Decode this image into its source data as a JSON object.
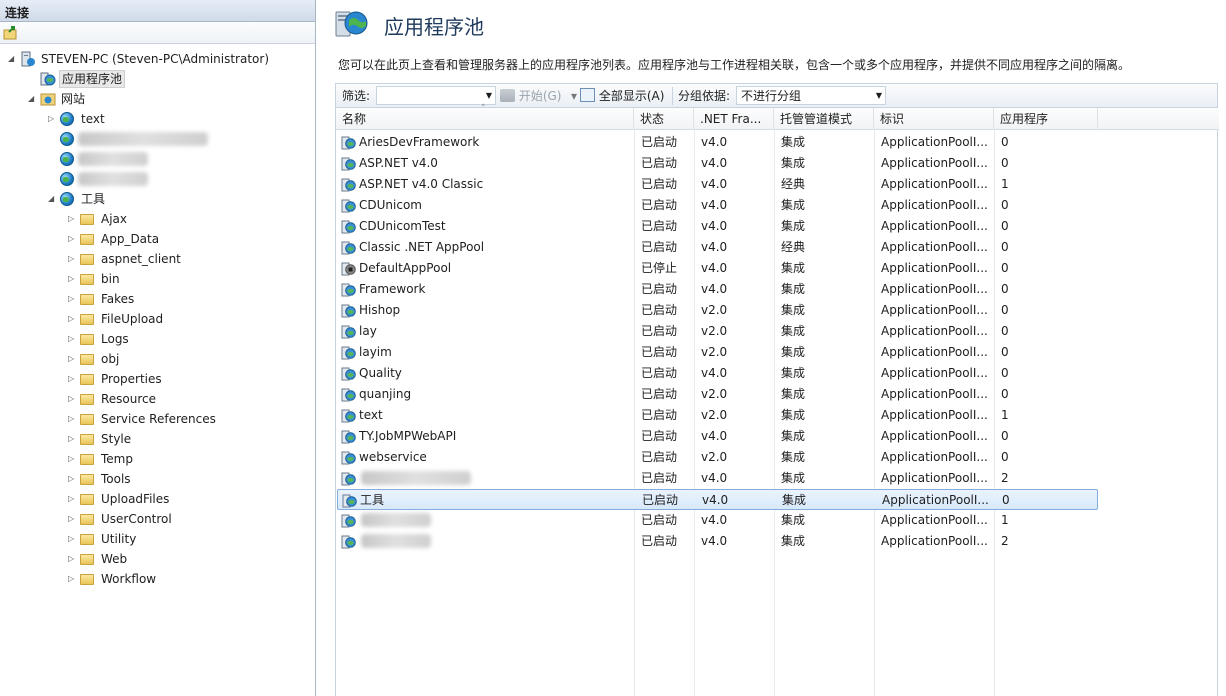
{
  "left": {
    "header": "连接",
    "tree": [
      {
        "label": "STEVEN-PC (Steven-PC\\Administrator)",
        "icon": "server-icon",
        "exp": "◢"
      },
      {
        "label": "应用程序池",
        "icon": "app-pool-icon",
        "sel": true
      },
      {
        "label": "网站",
        "icon": "sites-folder-icon",
        "exp": "◢"
      },
      {
        "label": "text",
        "icon": "globe-icon",
        "exp": "▷"
      },
      {
        "label": "",
        "icon": "globe-icon",
        "blur": 130
      },
      {
        "label": "",
        "icon": "globe-icon",
        "blur": 70
      },
      {
        "label": "",
        "icon": "globe-icon",
        "blur": 70
      },
      {
        "label": "工具",
        "icon": "globe-icon",
        "exp": "◢"
      },
      {
        "label": "Ajax",
        "icon": "folder-icon",
        "exp": "▷"
      },
      {
        "label": "App_Data",
        "icon": "folder-icon",
        "exp": "▷"
      },
      {
        "label": "aspnet_client",
        "icon": "folder-icon",
        "exp": "▷"
      },
      {
        "label": "bin",
        "icon": "folder-icon",
        "exp": "▷"
      },
      {
        "label": "Fakes",
        "icon": "folder-icon",
        "exp": "▷"
      },
      {
        "label": "FileUpload",
        "icon": "folder-icon",
        "exp": "▷"
      },
      {
        "label": "Logs",
        "icon": "folder-icon",
        "exp": "▷"
      },
      {
        "label": "obj",
        "icon": "folder-icon",
        "exp": "▷"
      },
      {
        "label": "Properties",
        "icon": "folder-icon",
        "exp": "▷"
      },
      {
        "label": "Resource",
        "icon": "folder-icon",
        "exp": "▷"
      },
      {
        "label": "Service References",
        "icon": "folder-icon",
        "exp": "▷"
      },
      {
        "label": "Style",
        "icon": "folder-icon",
        "exp": "▷"
      },
      {
        "label": "Temp",
        "icon": "folder-icon",
        "exp": "▷"
      },
      {
        "label": "Tools",
        "icon": "folder-icon",
        "exp": "▷"
      },
      {
        "label": "UploadFiles",
        "icon": "folder-icon",
        "exp": "▷"
      },
      {
        "label": "UserControl",
        "icon": "folder-icon",
        "exp": "▷"
      },
      {
        "label": "Utility",
        "icon": "folder-icon",
        "exp": "▷"
      },
      {
        "label": "Web",
        "icon": "folder-icon",
        "exp": "▷"
      },
      {
        "label": "Workflow",
        "icon": "folder-icon",
        "exp": "▷"
      }
    ]
  },
  "page": {
    "title": "应用程序池",
    "description": "您可以在此页上查看和管理服务器上的应用程序池列表。应用程序池与工作进程相关联，包含一个或多个应用程序，并提供不同应用程序之间的隔离。"
  },
  "filter": {
    "label": "筛选:",
    "go": "开始(G)",
    "showall": "全部显示(A)",
    "groupby": "分组依据:",
    "groupval": "不进行分组"
  },
  "grid": {
    "headers": [
      "名称",
      "状态",
      ".NET Fra...",
      "托管管道模式",
      "标识",
      "应用程序"
    ],
    "rows": [
      [
        "AriesDevFramework",
        "已启动",
        "v4.0",
        "集成",
        "ApplicationPoolI...",
        "0"
      ],
      [
        "ASP.NET v4.0",
        "已启动",
        "v4.0",
        "集成",
        "ApplicationPoolI...",
        "0"
      ],
      [
        "ASP.NET v4.0 Classic",
        "已启动",
        "v4.0",
        "经典",
        "ApplicationPoolI...",
        "1"
      ],
      [
        "CDUnicom",
        "已启动",
        "v4.0",
        "集成",
        "ApplicationPoolI...",
        "0"
      ],
      [
        "CDUnicomTest",
        "已启动",
        "v4.0",
        "集成",
        "ApplicationPoolI...",
        "0"
      ],
      [
        "Classic .NET AppPool",
        "已启动",
        "v4.0",
        "经典",
        "ApplicationPoolI...",
        "0"
      ],
      [
        "DefaultAppPool",
        "已停止",
        "v4.0",
        "集成",
        "ApplicationPoolI...",
        "0"
      ],
      [
        "Framework",
        "已启动",
        "v4.0",
        "集成",
        "ApplicationPoolI...",
        "0"
      ],
      [
        "Hishop",
        "已启动",
        "v2.0",
        "集成",
        "ApplicationPoolI...",
        "0"
      ],
      [
        "lay",
        "已启动",
        "v2.0",
        "集成",
        "ApplicationPoolI...",
        "0"
      ],
      [
        "layim",
        "已启动",
        "v2.0",
        "集成",
        "ApplicationPoolI...",
        "0"
      ],
      [
        "Quality",
        "已启动",
        "v4.0",
        "集成",
        "ApplicationPoolI...",
        "0"
      ],
      [
        "quanjing",
        "已启动",
        "v2.0",
        "集成",
        "ApplicationPoolI...",
        "0"
      ],
      [
        "text",
        "已启动",
        "v2.0",
        "集成",
        "ApplicationPoolI...",
        "1"
      ],
      [
        "TY.JobMPWebAPI",
        "已启动",
        "v4.0",
        "集成",
        "ApplicationPoolI...",
        "0"
      ],
      [
        "webservice",
        "已启动",
        "v2.0",
        "集成",
        "ApplicationPoolI...",
        "0"
      ],
      [
        "",
        "已启动",
        "v4.0",
        "集成",
        "ApplicationPoolI...",
        "2"
      ],
      [
        "工具",
        "已启动",
        "v4.0",
        "集成",
        "ApplicationPoolI...",
        "0"
      ],
      [
        "",
        "已启动",
        "v4.0",
        "集成",
        "ApplicationPoolI...",
        "1"
      ],
      [
        "",
        "已启动",
        "v4.0",
        "集成",
        "ApplicationPoolI...",
        "2"
      ]
    ],
    "selected_index": 17
  }
}
